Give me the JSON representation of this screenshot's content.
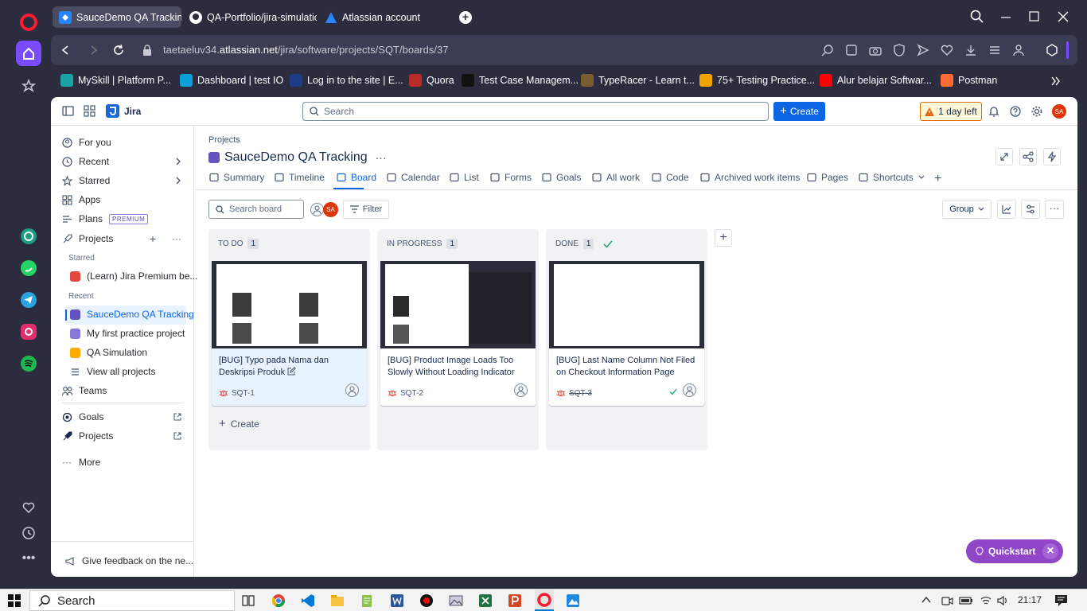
{
  "browser": {
    "tabs": [
      {
        "label": "SauceDemo QA Tracking -"
      },
      {
        "label": "QA-Portfolio/jira-simulatic"
      },
      {
        "label": "Atlassian account"
      }
    ],
    "url_prefix": "taetaeluv34.",
    "url_domain": "atlassian.net",
    "url_path": "/jira/software/projects/SQT/boards/37",
    "bookmarks": [
      {
        "label": "MySkill | Platform P...",
        "color": "#1aa3a3"
      },
      {
        "label": "Dashboard | test IO",
        "color": "#0aa0d8"
      },
      {
        "label": "Log in to the site | E...",
        "color": "#1f3c88"
      },
      {
        "label": "Quora",
        "color": "#b92b27"
      },
      {
        "label": "Test Case Managem...",
        "color": "#111111"
      },
      {
        "label": "TypeRacer - Learn t...",
        "color": "#7a5c2e"
      },
      {
        "label": "75+ Testing Practice...",
        "color": "#f0a500"
      },
      {
        "label": "Alur belajar Softwar...",
        "color": "#ff0000"
      },
      {
        "label": "Postman",
        "color": "#ff6c37"
      }
    ]
  },
  "jira": {
    "product": "Jira",
    "search_placeholder": "Search",
    "create_label": "Create",
    "trial_label": "1 day left",
    "avatar_initials": "SA",
    "sidebar": {
      "for_you": "For you",
      "recent": "Recent",
      "starred": "Starred",
      "apps": "Apps",
      "plans": "Plans",
      "premium": "PREMIUM",
      "projects": "Projects",
      "starred_header": "Starred",
      "starred_project": "(Learn) Jira Premium be...",
      "recent_header": "Recent",
      "recent_projects": [
        "SauceDemo QA Tracking",
        "My first practice project",
        "QA Simulation"
      ],
      "view_all": "View all projects",
      "teams": "Teams",
      "goals": "Goals",
      "projects_link": "Projects",
      "more": "More",
      "feedback": "Give feedback on the ne..."
    },
    "breadcrumb": "Projects",
    "project_title": "SauceDemo QA Tracking",
    "tabs": [
      "Summary",
      "Timeline",
      "Board",
      "Calendar",
      "List",
      "Forms",
      "Goals",
      "All work",
      "Code",
      "Archived work items",
      "Pages",
      "Shortcuts"
    ],
    "search_board_placeholder": "Search board",
    "filter_label": "Filter",
    "group_label": "Group",
    "columns": [
      {
        "name": "TO DO",
        "count": "1",
        "card_title": "[BUG] Typo pada Nama dan Deskripsi Produk",
        "card_key": "SQT-1",
        "create": "Create"
      },
      {
        "name": "IN PROGRESS",
        "count": "1",
        "card_title": "[BUG] Product Image Loads Too Slowly Without Loading Indicator",
        "card_key": "SQT-2"
      },
      {
        "name": "DONE",
        "count": "1",
        "card_title": "[BUG] Last Name Column Not Filed on Checkout Information Page",
        "card_key": "SQT-3"
      }
    ],
    "quickstart": "Quickstart"
  },
  "taskbar": {
    "search": "Search",
    "time": "21:17"
  },
  "colors": {
    "accent": "#0c66e4",
    "quickstart": "#8f47c7",
    "bug": "#e2483d"
  }
}
